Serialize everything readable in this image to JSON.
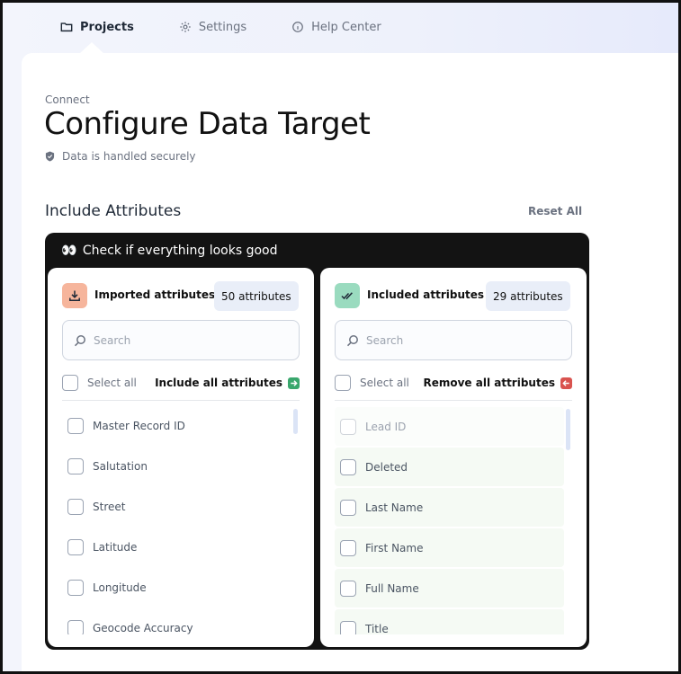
{
  "nav": {
    "items": [
      {
        "label": "Projects",
        "icon": "folder-icon",
        "active": true
      },
      {
        "label": "Settings",
        "icon": "gear-icon",
        "active": false
      },
      {
        "label": "Help Center",
        "icon": "info-icon",
        "active": false
      }
    ]
  },
  "header": {
    "breadcrumb": "Connect",
    "title": "Configure Data Target",
    "secure_note": "Data is handled securely"
  },
  "section": {
    "title": "Include Attributes",
    "reset_label": "Reset All"
  },
  "review": {
    "emoji": "👀",
    "title": "Check if everything looks good"
  },
  "imported": {
    "title": "Imported attributes",
    "count": "50 attributes",
    "search_placeholder": "Search",
    "select_all": "Select all",
    "bulk_action": "Include all attributes",
    "icon": "download-icon",
    "icon_bg": "#f6b59c",
    "action_color": "#3aa76d",
    "items": [
      "Master Record ID",
      "Salutation",
      "Street",
      "Latitude",
      "Longitude",
      "Geocode Accuracy"
    ]
  },
  "included": {
    "title": "Included attributes",
    "count": "29 attributes",
    "search_placeholder": "Search",
    "select_all": "Select all",
    "bulk_action": "Remove all attributes",
    "icon": "double-check-icon",
    "icon_bg": "#9adbbf",
    "action_color": "#d9534f",
    "items": [
      "Lead ID",
      "Deleted",
      "Last Name",
      "First Name",
      "Full Name",
      "Title"
    ]
  }
}
